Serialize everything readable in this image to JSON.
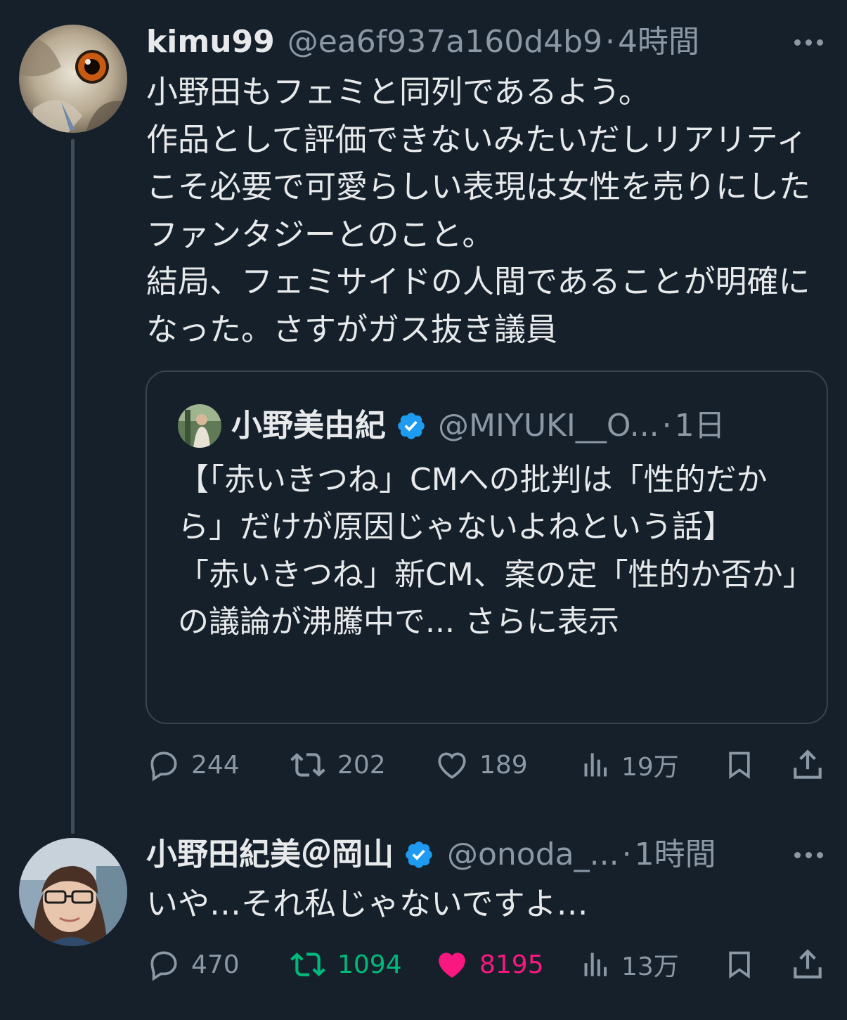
{
  "thread": {
    "tweet1": {
      "display_name": "kimu99",
      "handle": "@ea6f937a160d4b9",
      "separator": "·",
      "time": "4時間",
      "avatar_icon": "owl-avatar",
      "body": "小野田もフェミと同列であるよう。\n作品として評価できないみたいだしリアリティこそ必要で可愛らしい表現は女性を売りにしたファンタジーとのこと。\n結局、フェミサイドの人間であることが明確になった。さすがガス抜き議員",
      "quote": {
        "display_name": "小野美由紀",
        "verified": true,
        "handle": "@MIYUKI__O...",
        "separator": "·",
        "time": "1日",
        "body": "【「赤いきつね」CMへの批判は「性的だから」だけが原因じゃないよねという話】\n「赤いきつね」新CM、案の定「性的か否か」の議論が沸騰中で... ",
        "show_more": "さらに表示"
      },
      "actions": {
        "replies": "244",
        "retweets": "202",
        "likes": "189",
        "views": "19万"
      }
    },
    "tweet2": {
      "display_name": "小野田紀美＠岡山",
      "verified": true,
      "handle": "@onoda_...",
      "separator": "·",
      "time": "1時間",
      "avatar_icon": "woman-avatar",
      "body": "いや…それ私じゃないですよ…",
      "actions": {
        "replies": "470",
        "retweets": "1094",
        "likes": "8195",
        "views": "13万",
        "retweeted": true,
        "liked": true
      }
    }
  },
  "colors": {
    "background": "#15202b",
    "text": "#e7e9ea",
    "muted": "#8b98a5",
    "verified": "#1d9bf0",
    "retweet_active": "#00ba7c",
    "like_active": "#f91880",
    "border": "#38444d"
  }
}
